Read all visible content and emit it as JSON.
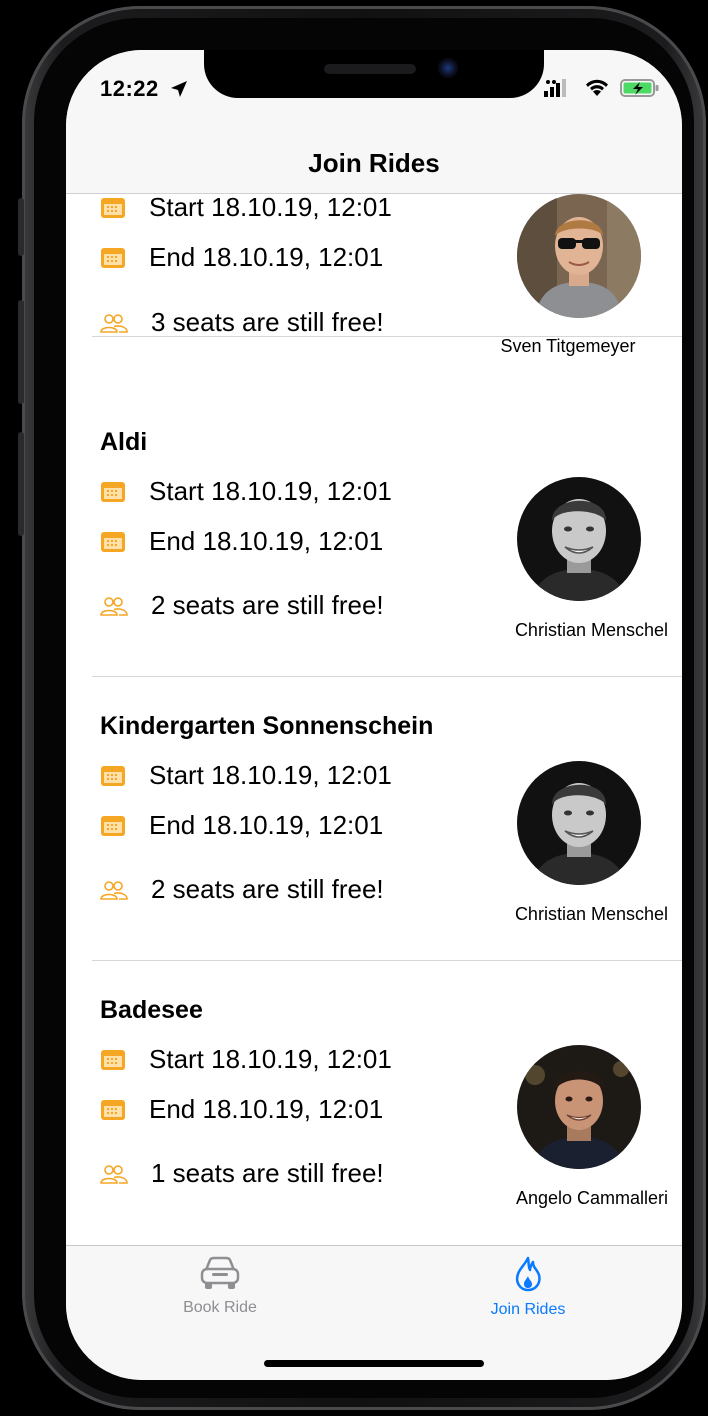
{
  "status_bar": {
    "time": "12:22"
  },
  "nav": {
    "title": "Join Rides"
  },
  "rides": [
    {
      "title": "",
      "start": "Start 18.10.19, 12:01",
      "end": "End 18.10.19, 12:01",
      "seats": "3 seats are still free!",
      "driver": "Sven Titgemeyer"
    },
    {
      "title": "Aldi",
      "start": "Start 18.10.19, 12:01",
      "end": "End 18.10.19, 12:01",
      "seats": "2 seats are still free!",
      "driver": "Christian Menschel"
    },
    {
      "title": "Kindergarten Sonnenschein",
      "start": "Start 18.10.19, 12:01",
      "end": "End 18.10.19, 12:01",
      "seats": "2 seats are still free!",
      "driver": "Christian Menschel"
    },
    {
      "title": "Badesee",
      "start": "Start 18.10.19, 12:01",
      "end": "End 18.10.19, 12:01",
      "seats": "1 seats are still free!",
      "driver": "Angelo Cammalleri"
    }
  ],
  "tabs": [
    {
      "label": "Book Ride",
      "icon": "car-icon",
      "selected": false
    },
    {
      "label": "Join Rides",
      "icon": "flame-icon",
      "selected": true
    }
  ],
  "colors": {
    "accent": "#F5A623",
    "tab_selected": "#0A7AFF",
    "tab_unselected": "#8E8E93"
  }
}
